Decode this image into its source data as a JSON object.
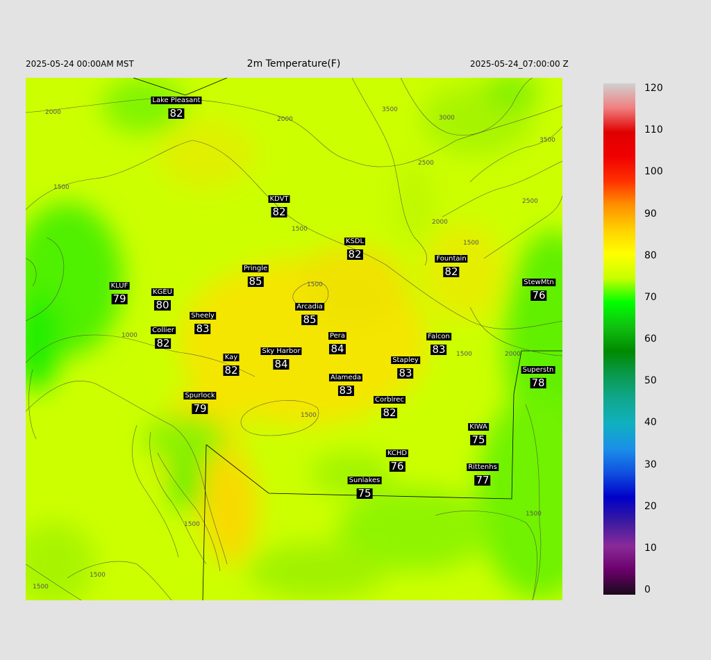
{
  "header": {
    "left": "2025-05-24 00:00AM MST",
    "title": "2m Temperature(F)",
    "right": "2025-05-24_07:00:00 Z"
  },
  "stations": [
    {
      "name": "Lake Pleasant",
      "value": "82"
    },
    {
      "name": "KDVT",
      "value": "82"
    },
    {
      "name": "KSDL",
      "value": "82"
    },
    {
      "name": "Fountain",
      "value": "82"
    },
    {
      "name": "Pringle",
      "value": "85"
    },
    {
      "name": "KLUF",
      "value": "79"
    },
    {
      "name": "KGEU",
      "value": "80"
    },
    {
      "name": "StewMtn",
      "value": "76"
    },
    {
      "name": "Arcadia",
      "value": "85"
    },
    {
      "name": "Sheely",
      "value": "83"
    },
    {
      "name": "Collier",
      "value": "82"
    },
    {
      "name": "Pera",
      "value": "84"
    },
    {
      "name": "Falcon",
      "value": "83"
    },
    {
      "name": "Sky Harbor",
      "value": "84"
    },
    {
      "name": "Kay",
      "value": "82"
    },
    {
      "name": "Stapley",
      "value": "83"
    },
    {
      "name": "Superstn",
      "value": "78"
    },
    {
      "name": "Alameda",
      "value": "83"
    },
    {
      "name": "Spurlock",
      "value": "79"
    },
    {
      "name": "Corblrec",
      "value": "82"
    },
    {
      "name": "KIWA",
      "value": "75"
    },
    {
      "name": "KCHD",
      "value": "76"
    },
    {
      "name": "Rittenhs",
      "value": "77"
    },
    {
      "name": "Sunlakes",
      "value": "75"
    }
  ],
  "contour_labels": [
    "2000",
    "2000",
    "3500",
    "3000",
    "3500",
    "2500",
    "2500",
    "1500",
    "2000",
    "1500",
    "1500",
    "1500",
    "1000",
    "1500",
    "2000",
    "1500",
    "1500",
    "1500",
    "1500",
    "1500"
  ],
  "colorbar": {
    "ticks": [
      "120",
      "110",
      "100",
      "90",
      "80",
      "70",
      "60",
      "50",
      "40",
      "30",
      "20",
      "10",
      "0"
    ],
    "min": 0,
    "max": 120,
    "colors": [
      "#1a0a1a",
      "#6a006a",
      "#8a2a9a",
      "#3a1aa0",
      "#0000c8",
      "#1050e0",
      "#1a90e8",
      "#10b0c0",
      "#10a890",
      "#0a9a50",
      "#008a00",
      "#10c010",
      "#00ff00",
      "#c8ff00",
      "#ffff00",
      "#ffd000",
      "#ff9000",
      "#ff3000",
      "#f00000",
      "#e00000",
      "#f08080",
      "#d0d0d0"
    ]
  }
}
